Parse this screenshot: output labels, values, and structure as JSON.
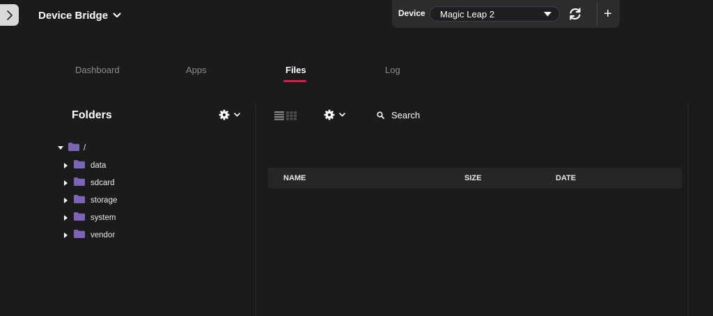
{
  "app": {
    "title": "Device Bridge"
  },
  "device": {
    "label": "Device",
    "selected": "Magic Leap 2",
    "add_label": "+"
  },
  "tabs": [
    {
      "label": "Dashboard",
      "active": false
    },
    {
      "label": "Apps",
      "active": false
    },
    {
      "label": "Files",
      "active": true
    },
    {
      "label": "Log",
      "active": false
    }
  ],
  "folders": {
    "title": "Folders",
    "root": "/",
    "items": [
      "data",
      "sdcard",
      "storage",
      "system",
      "vendor"
    ]
  },
  "files": {
    "search_label": "Search",
    "columns": [
      "NAME",
      "SIZE",
      "DATE"
    ]
  },
  "colors": {
    "accent": "#e8173f",
    "folder": "#7c64b6",
    "background": "#1b1b1c"
  }
}
